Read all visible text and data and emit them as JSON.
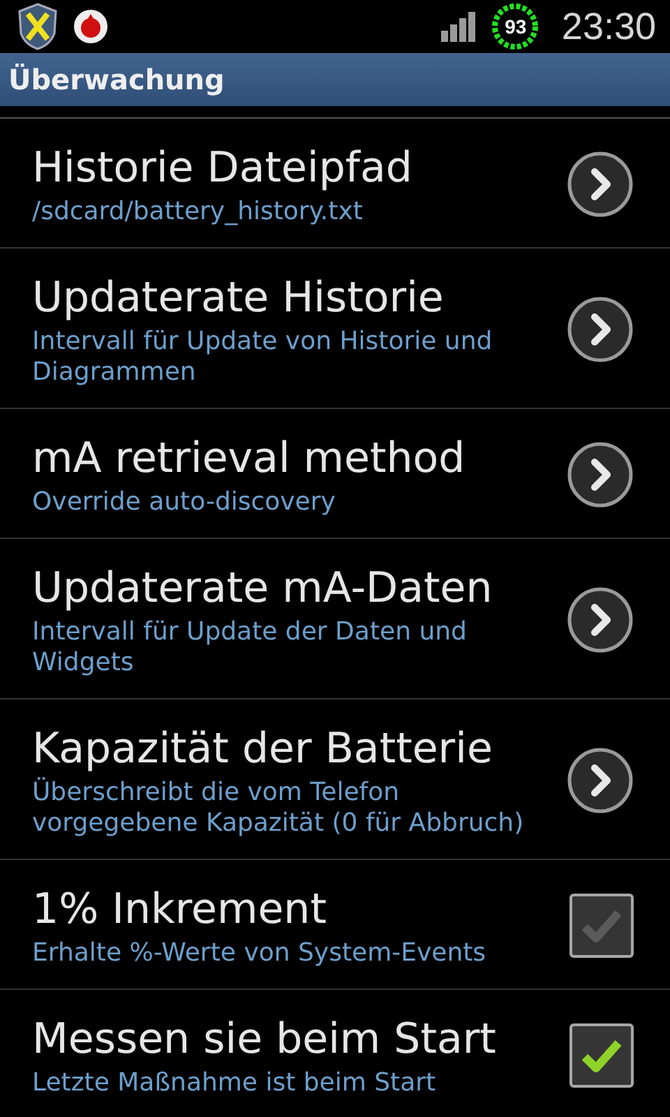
{
  "status_bar": {
    "battery_percent": "93",
    "time": "23:30"
  },
  "title_bar": {
    "title": "Überwachung"
  },
  "preferences": [
    {
      "title": "Historie Dateipfad",
      "summary": "/sdcard/battery_history.txt",
      "kind": "arrow"
    },
    {
      "title": "Updaterate Historie",
      "summary": "Intervall für Update von Historie und Diagrammen",
      "kind": "arrow"
    },
    {
      "title": "mA retrieval method",
      "summary": "Override auto-discovery",
      "kind": "arrow"
    },
    {
      "title": "Updaterate mA-Daten",
      "summary": "Intervall für Update der Daten und Widgets",
      "kind": "arrow"
    },
    {
      "title": "Kapazität der Batterie",
      "summary": "Überschreibt die vom Telefon vorgegebene Kapazität (0 für Abbruch)",
      "kind": "arrow"
    },
    {
      "title": "1% Inkrement",
      "summary": "Erhalte %-Werte von System-Events",
      "kind": "checkbox",
      "checked": false
    },
    {
      "title": "Messen sie beim Start",
      "summary": "Letzte Maßnahme ist beim Start",
      "kind": "checkbox",
      "checked": true
    }
  ]
}
